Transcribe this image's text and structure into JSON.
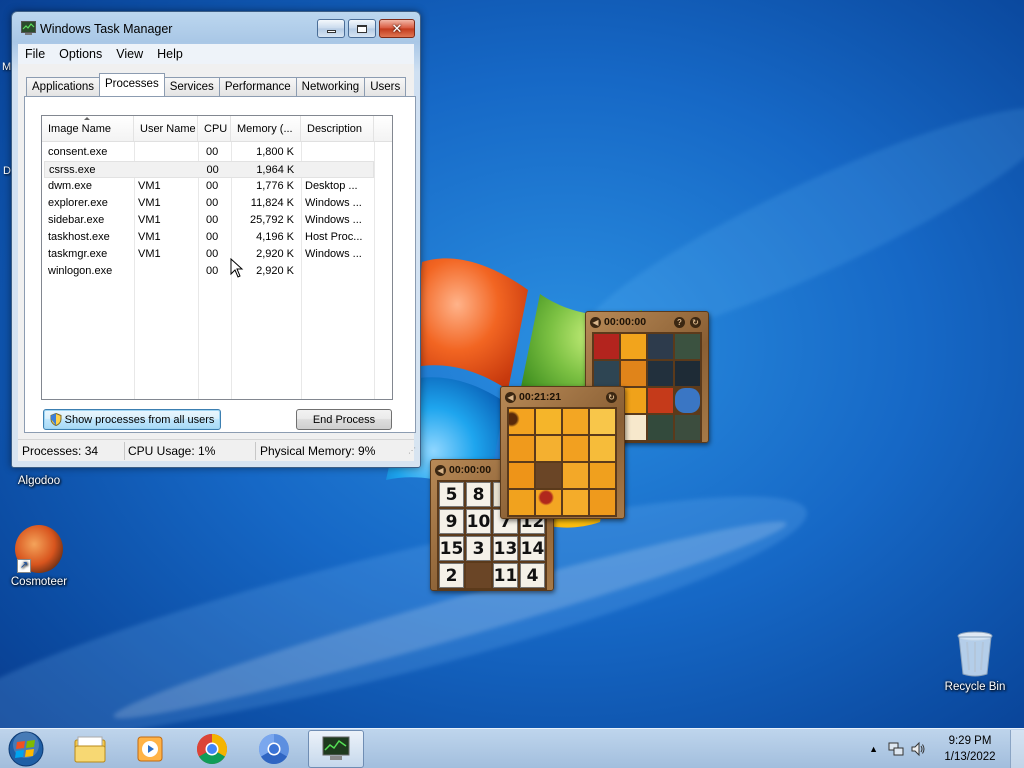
{
  "desktop": {
    "icons": [
      {
        "name": "algodoo-icon",
        "label": "Algodoo"
      },
      {
        "name": "cosmoteer-icon",
        "label": "Cosmoteer"
      },
      {
        "name": "recycle-bin-icon",
        "label": "Recycle Bin"
      }
    ],
    "edge_letters": [
      "M",
      "D"
    ]
  },
  "gadgets": {
    "picture_puzzle_1": {
      "timer": "00:00:00"
    },
    "picture_puzzle_2": {
      "timer": "00:21:21"
    },
    "number_puzzle": {
      "timer": "00:00:00",
      "tiles": [
        "5",
        "8",
        "",
        "",
        "9",
        "10",
        "7",
        "12",
        "15",
        "3",
        "13",
        "14",
        "2",
        "",
        "11",
        "4"
      ]
    }
  },
  "task_manager": {
    "title": "Windows Task Manager",
    "menu": [
      "File",
      "Options",
      "View",
      "Help"
    ],
    "tabs": [
      "Applications",
      "Processes",
      "Services",
      "Performance",
      "Networking",
      "Users"
    ],
    "active_tab": "Processes",
    "columns": [
      "Image Name",
      "User Name",
      "CPU",
      "Memory (...",
      "Description"
    ],
    "rows": [
      {
        "name": "consent.exe",
        "user": "",
        "cpu": "00",
        "mem": "1,800 K",
        "desc": ""
      },
      {
        "name": "csrss.exe",
        "user": "",
        "cpu": "00",
        "mem": "1,964 K",
        "desc": ""
      },
      {
        "name": "dwm.exe",
        "user": "VM1",
        "cpu": "00",
        "mem": "1,776 K",
        "desc": "Desktop ..."
      },
      {
        "name": "explorer.exe",
        "user": "VM1",
        "cpu": "00",
        "mem": "11,824 K",
        "desc": "Windows ..."
      },
      {
        "name": "sidebar.exe",
        "user": "VM1",
        "cpu": "00",
        "mem": "25,792 K",
        "desc": "Windows ..."
      },
      {
        "name": "taskhost.exe",
        "user": "VM1",
        "cpu": "00",
        "mem": "4,196 K",
        "desc": "Host Proc..."
      },
      {
        "name": "taskmgr.exe",
        "user": "VM1",
        "cpu": "00",
        "mem": "2,920 K",
        "desc": "Windows ..."
      },
      {
        "name": "winlogon.exe",
        "user": "",
        "cpu": "00",
        "mem": "2,920 K",
        "desc": ""
      }
    ],
    "show_all_button": "Show processes from all users",
    "end_process_button": "End Process",
    "status": {
      "processes": "Processes: 34",
      "cpu": "CPU Usage: 1%",
      "memory": "Physical Memory: 9%"
    }
  },
  "taskbar": {
    "items": [
      "start-button",
      "explorer-icon",
      "media-player-icon",
      "chrome-icon",
      "chromium-icon",
      "task-manager-icon"
    ],
    "clock": {
      "time": "9:29 PM",
      "date": "1/13/2022"
    }
  },
  "colors": {
    "desktop_blue": "#1668c6",
    "window_frame": "#a9c7e6",
    "close_red": "#c23a1c",
    "gadget_wood": "#a77a48"
  }
}
